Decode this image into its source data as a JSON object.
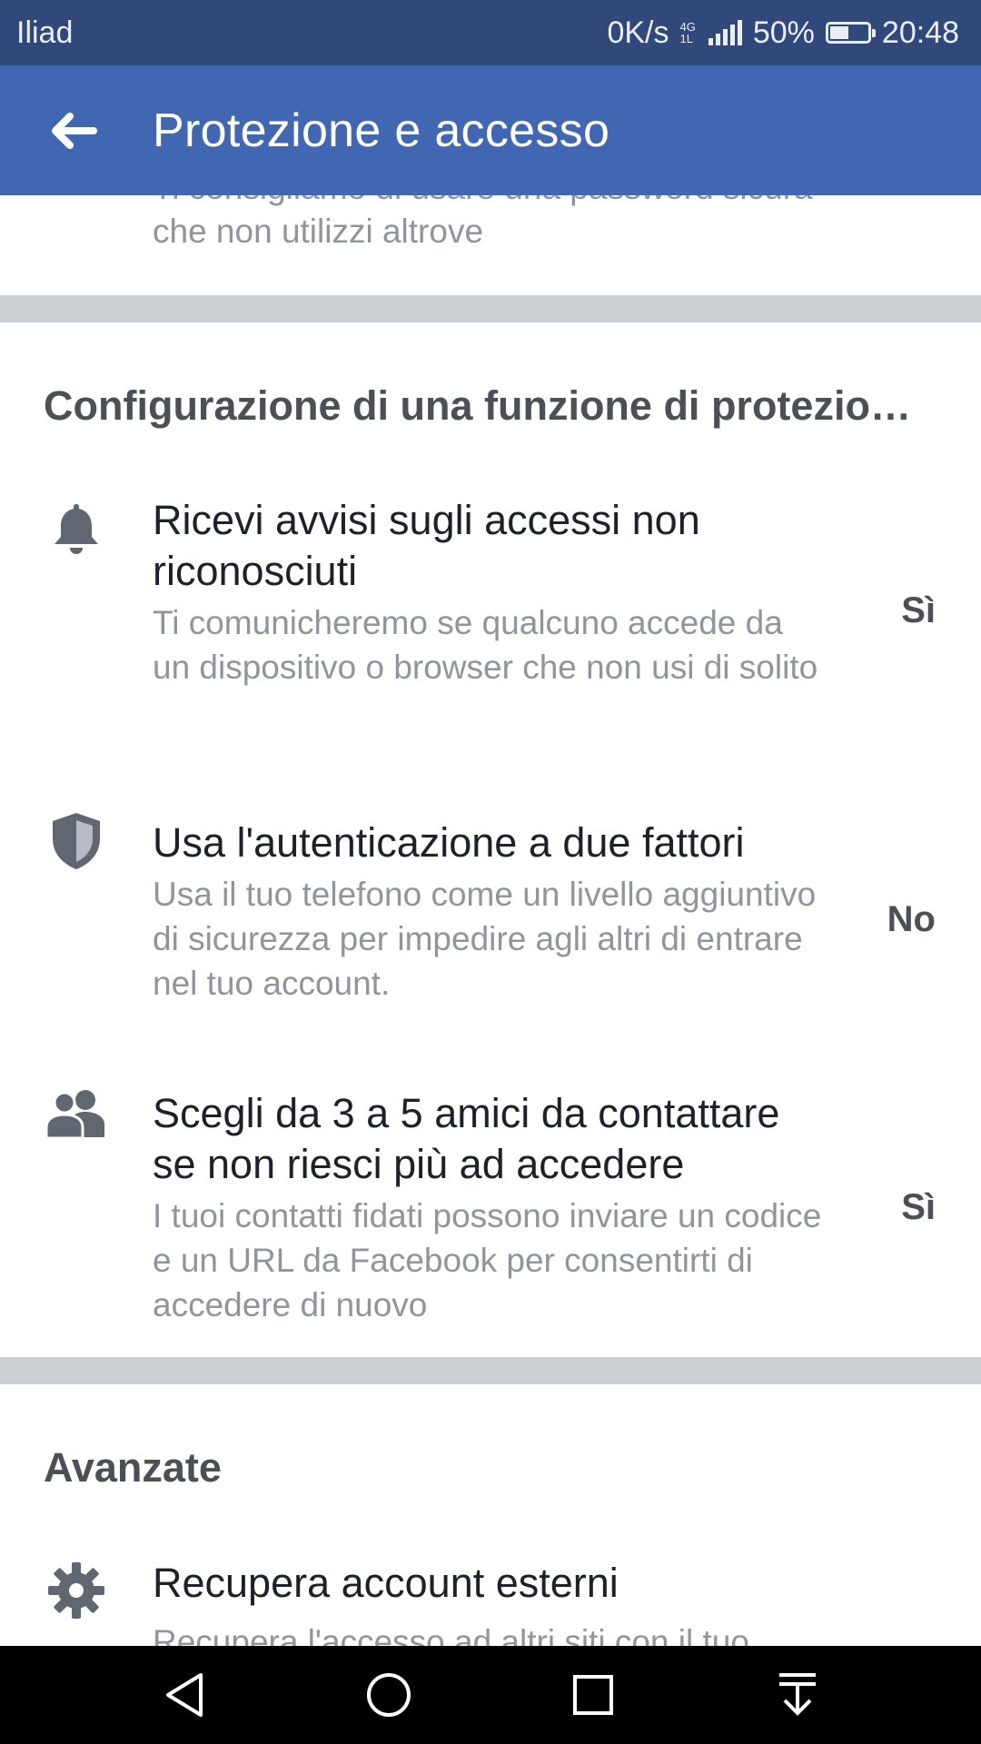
{
  "status_bar": {
    "carrier": "Iliad",
    "speed": "0K/s",
    "network_top": "4G",
    "network_bottom": "1L",
    "battery_percent": "50%",
    "battery_level": 0.5,
    "time": "20:48"
  },
  "header": {
    "title": "Protezione e accesso",
    "back_icon": "arrow-left-icon",
    "background": "#4267b2"
  },
  "top_partial": {
    "line1": "Ti consigliamo di usare una password sicura",
    "line2": "che non utilizzi altrove"
  },
  "section_setup": {
    "title": "Configurazione di una funzione di protezione aggiuntiva",
    "items": [
      {
        "icon": "bell-icon",
        "title": "Ricevi avvisi sugli accessi non riconosciuti",
        "description": "Ti comunicheremo se qualcuno accede da un dispositivo o browser che non usi di solito",
        "value": "Sì"
      },
      {
        "icon": "shield-icon",
        "title": "Usa l'autenticazione a due fattori",
        "description": "Usa il tuo telefono come un livello aggiuntivo di sicurezza per impedire agli altri di entrare nel tuo account.",
        "value": "No"
      },
      {
        "icon": "friends-icon",
        "title": "Scegli da 3 a 5 amici da contattare se non riesci più ad accedere",
        "description": "I tuoi contatti fidati possono inviare un codice e un URL da Facebook per consentirti di accedere di nuovo",
        "value": "Sì"
      }
    ]
  },
  "section_advanced": {
    "title": "Avanzate",
    "items": [
      {
        "icon": "gear-icon",
        "title": "Recupera account esterni",
        "description": "Recupera l'accesso ad altri siti con il tuo"
      }
    ]
  },
  "nav_bar": {
    "back": "back-triangle-icon",
    "home": "home-circle-icon",
    "recents": "recents-square-icon",
    "notifications": "pull-down-icon"
  }
}
